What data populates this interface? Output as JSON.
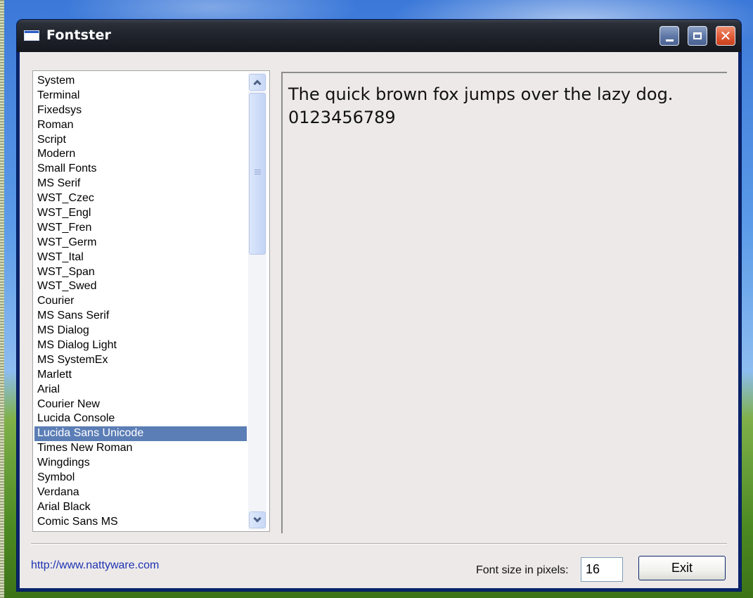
{
  "window": {
    "title": "Fontster"
  },
  "font_list": {
    "items": [
      "System",
      "Terminal",
      "Fixedsys",
      "Roman",
      "Script",
      "Modern",
      "Small Fonts",
      "MS Serif",
      "WST_Czec",
      "WST_Engl",
      "WST_Fren",
      "WST_Germ",
      "WST_Ital",
      "WST_Span",
      "WST_Swed",
      "Courier",
      "MS Sans Serif",
      "MS Dialog",
      "MS Dialog Light",
      "MS SystemEx",
      "Marlett",
      "Arial",
      "Courier New",
      "Lucida Console",
      "Lucida Sans Unicode",
      "Times New Roman",
      "Wingdings",
      "Symbol",
      "Verdana",
      "Arial Black",
      "Comic Sans MS"
    ],
    "selected": "Lucida Sans Unicode"
  },
  "preview": {
    "line1": "The quick brown fox jumps over the lazy dog.",
    "line2": "0123456789"
  },
  "footer": {
    "link_text": "http://www.nattyware.com",
    "size_label": "Font size in pixels:",
    "size_value": "16",
    "exit_label": "Exit"
  },
  "icons": {
    "app": "window-app-icon",
    "minimize": "minimize-icon",
    "maximize": "maximize-icon",
    "close": "close-icon",
    "scroll_up": "chevron-up-icon",
    "scroll_down": "chevron-down-icon"
  },
  "colors": {
    "selection": "#5c7eb6",
    "titlebar": "#1f232b",
    "link": "#1f33b3",
    "close_button": "#e05a36"
  }
}
